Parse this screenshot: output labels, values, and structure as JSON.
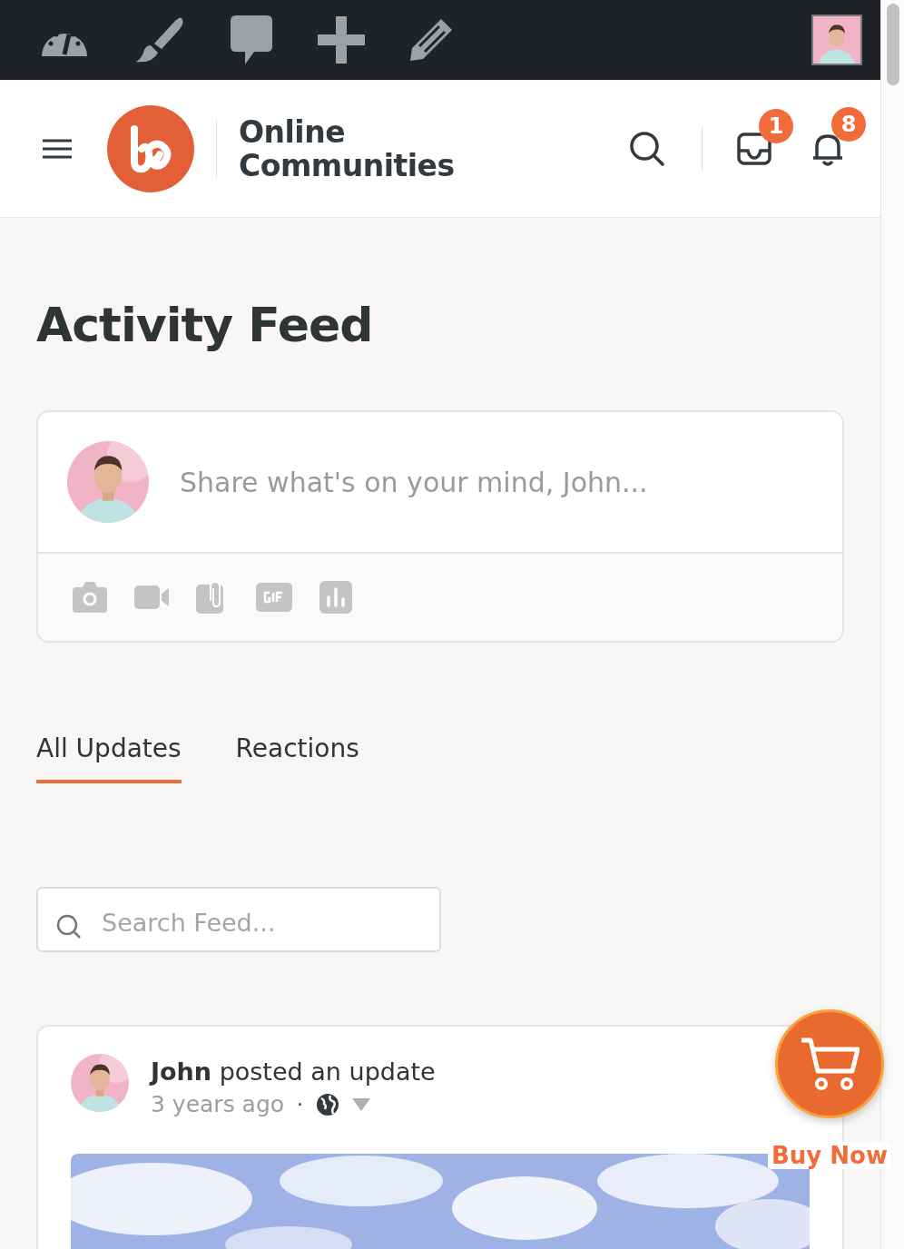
{
  "header": {
    "site_name": "Online Communities",
    "badges": [
      {
        "kind": "messages",
        "count": "1"
      },
      {
        "kind": "notifications",
        "count": "8"
      }
    ]
  },
  "page_title": "Activity Feed",
  "composer": {
    "placeholder": "Share what's on your mind, John..."
  },
  "tabs": [
    {
      "label": "All Updates",
      "selected": true
    },
    {
      "label": "Reactions",
      "selected": false
    }
  ],
  "search": {
    "placeholder": "Search Feed..."
  },
  "post": {
    "headline": "**John** posted an update",
    "time": "3 years ago",
    "separator": "·"
  },
  "buy_now": {
    "label": "Buy Now"
  }
}
